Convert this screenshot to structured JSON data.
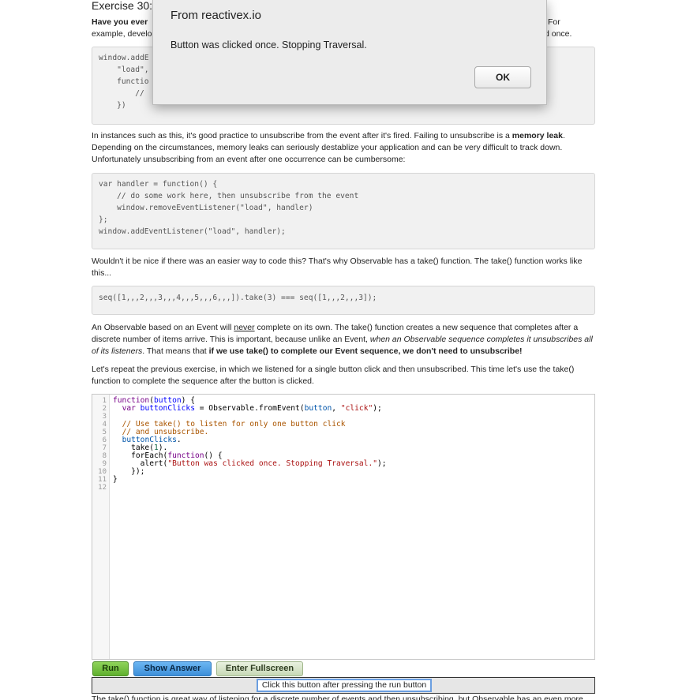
{
  "exercise_title": "Exercise 30:",
  "intro": {
    "bold_start": "Have you ever ",
    "right_end1": "For",
    "line2_start": "example, develo",
    "right_end2": "d once."
  },
  "code1": {
    "lines": [
      "window.addE",
      "    \"load\",",
      "    functio",
      "        //",
      "    })"
    ]
  },
  "para2": {
    "t1": "In instances such as this, it's good practice to unsubscribe from the event after it's fired. Failing to unsubscribe is a ",
    "bold": "memory leak",
    "t2": ". Depending on the circumstances, memory leaks can seriously destablize your application and can be very difficult to track down. Unfortunately unsubscribing from an event after one occurrence can be cumbersome:"
  },
  "code2": "var handler = function() {\n    // do some work here, then unsubscribe from the event\n    window.removeEventListener(\"load\", handler)\n};\nwindow.addEventListener(\"load\", handler);",
  "para3": "Wouldn't it be nice if there was an easier way to code this? That's why Observable has a take() function. The take() function works like this...",
  "code3": "seq([1,,,2,,,3,,,4,,,5,,,6,,,]).take(3) === seq([1,,,2,,,3]);",
  "para4": {
    "t1": "An Observable based on an Event will ",
    "never": "never",
    "t2": " complete on its own. The take() function creates a new sequence that completes after a discrete number of items arrive. This is important, because unlike an Event, ",
    "italic": "when an Observable sequence completes it unsubscribes all of its listeners",
    "t3": ". That means that ",
    "bold": "if we use take() to complete our Event sequence, we don't need to unsubscribe!"
  },
  "para5": "Let's repeat the previous exercise, in which we listened for a single button click and then unsubscribed. This time let's use the take() function to complete the sequence after the button is clicked.",
  "editor": {
    "line_numbers": [
      "1",
      "2",
      "3",
      "4",
      "5",
      "6",
      "7",
      "8",
      "9",
      "10",
      "11",
      "12"
    ]
  },
  "buttons": {
    "run": "Run",
    "show_answer": "Show Answer",
    "fullscreen": "Enter Fullscreen"
  },
  "output_button": "Click this button after pressing the run button",
  "tail_text": "The take() function is great way of listening for a discrete number of events and then unsubscribing, but Observable has an even more",
  "dialog": {
    "title": "From reactivex.io",
    "message": "Button was clicked once. Stopping Traversal.",
    "ok": "OK"
  }
}
